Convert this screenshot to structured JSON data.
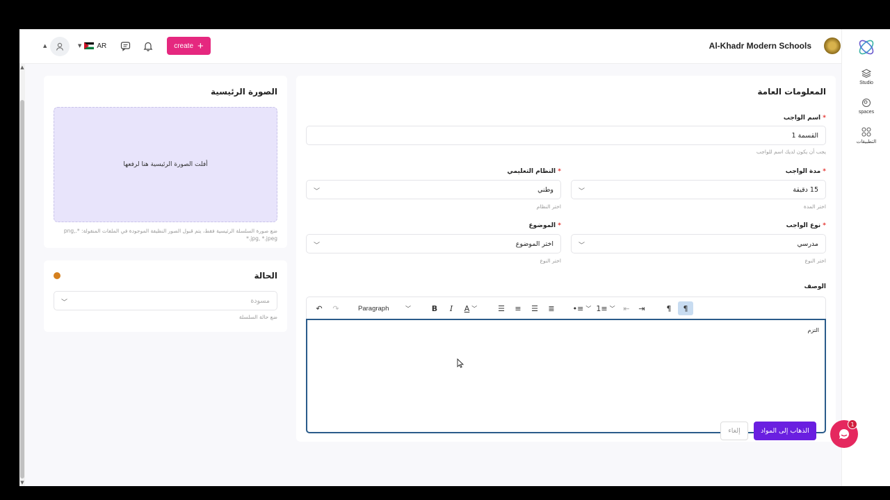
{
  "header": {
    "school_name": "Al-Khadr Modern Schools",
    "language": "AR",
    "create_label": "create",
    "create_icon": "plus-icon"
  },
  "rail": [
    {
      "label": "Studio",
      "icon": "layers-icon"
    },
    {
      "label": "spaces",
      "icon": "orbit-icon"
    },
    {
      "label": "التطبيقات",
      "icon": "apps-grid-icon"
    }
  ],
  "general": {
    "title": "المعلومات العامة",
    "name_label": "اسم الواجب",
    "name_value": "القسمة 1",
    "name_hint": "يجب أن يكون لديك اسم للواجب",
    "duration_label": "مدة الواجب",
    "duration_value": "15 دقيقة",
    "duration_hint": "اختر المدة",
    "system_label": "النظام التعليمي",
    "system_value": "وطني",
    "system_hint": "اختر النظام",
    "type_label": "نوع الواجب",
    "type_value": "مدرسي",
    "type_hint": "اختر النوع",
    "subject_label": "الموضوع",
    "subject_value": "اختر الموضوع",
    "subject_hint": "اختر النوع",
    "description_label": "الوصف",
    "editor_text": "التزم",
    "paragraph_style": "Paragraph"
  },
  "image": {
    "title": "الصورة الرئيسية",
    "drop_text": "أفلت الصورة الرئيسية هنا لرفعها",
    "hint": "ضع صورة السلسلة الرئيسية فقط، يتم قبول الصور النظيفة الموجودة في الملفات المنقولة: *.png, *.jpg, *.jpeg"
  },
  "status": {
    "title": "الحالة",
    "value": "مسودة",
    "hint": "ضع حالة السلسلة",
    "dot_color": "#d5801e"
  },
  "footer": {
    "submit_label": "الذهاب إلى المواد",
    "cancel_label": "إلغاء"
  },
  "chat": {
    "badge": "1"
  }
}
